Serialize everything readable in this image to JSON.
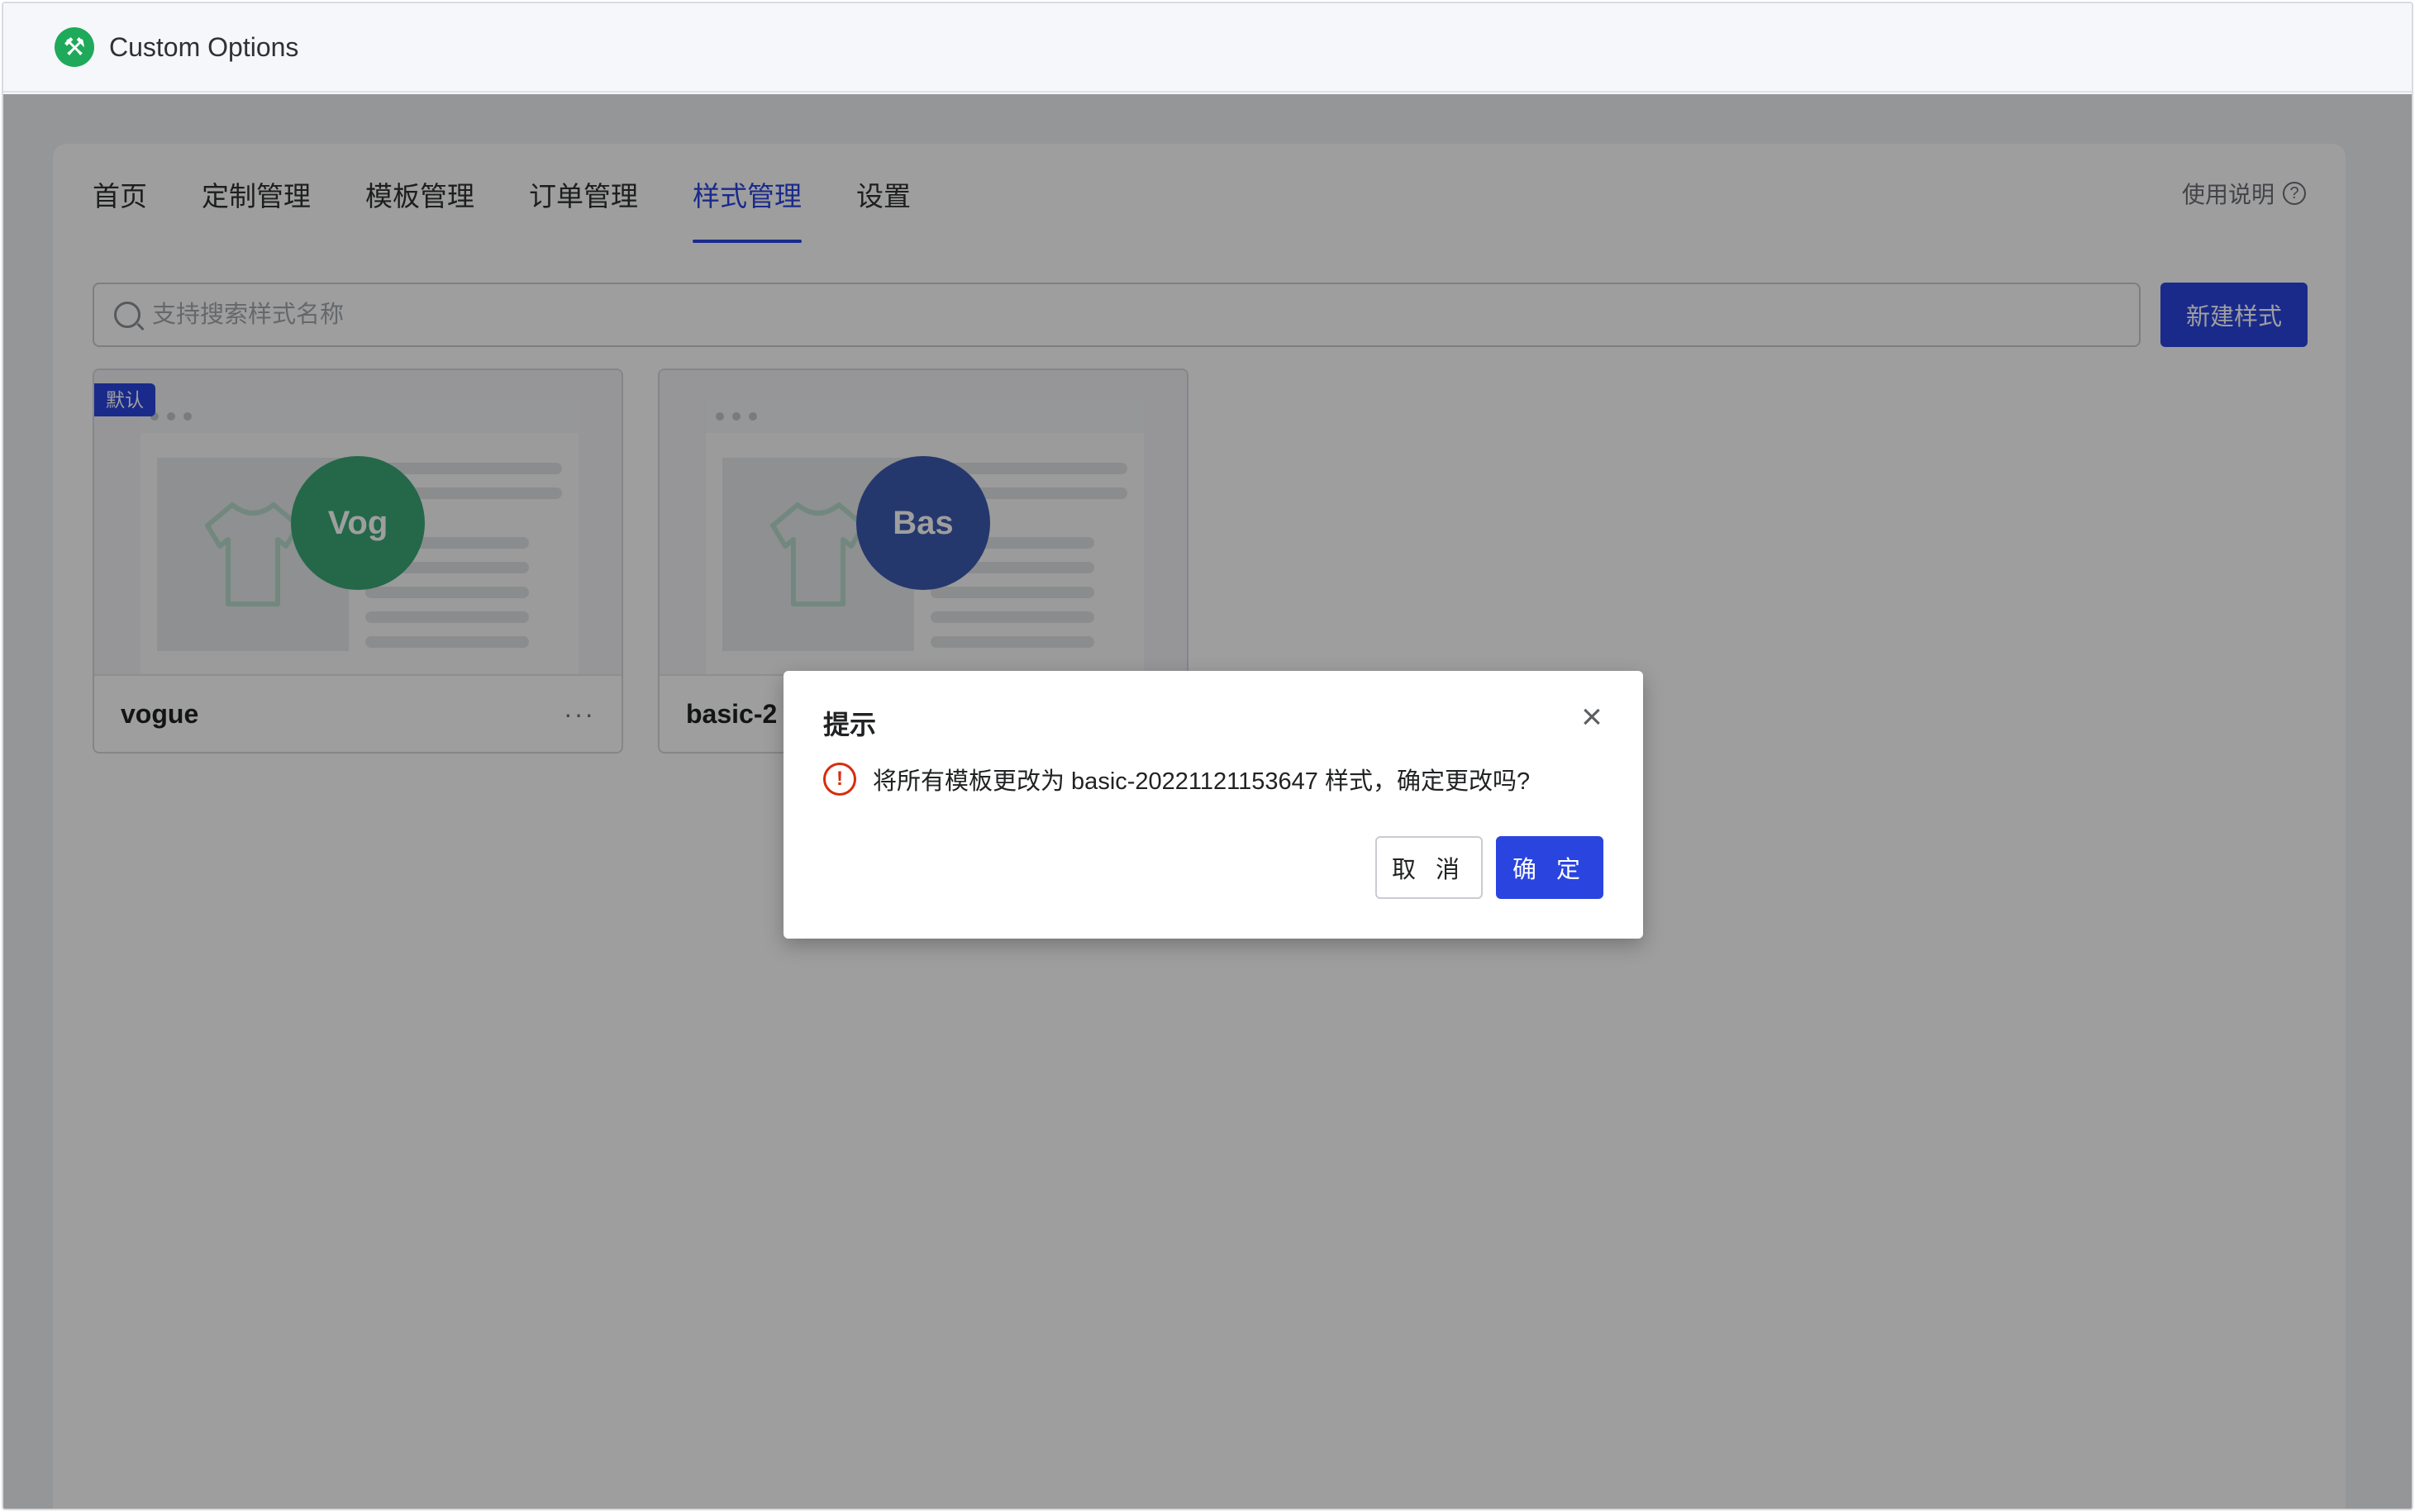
{
  "app": {
    "title": "Custom Options",
    "logo_icon": "tools-icon",
    "accent": "#1fa95b"
  },
  "nav": {
    "tabs": [
      {
        "label": "首页"
      },
      {
        "label": "定制管理"
      },
      {
        "label": "模板管理"
      },
      {
        "label": "订单管理"
      },
      {
        "label": "样式管理",
        "active": true
      },
      {
        "label": "设置"
      }
    ],
    "help_label": "使用说明"
  },
  "search": {
    "placeholder": "支持搜索样式名称",
    "value": ""
  },
  "toolbar": {
    "new_style_label": "新建样式"
  },
  "styles": [
    {
      "name": "vogue",
      "avatar_text": "Vog",
      "avatar_color": "#1fa95b",
      "badge": "默认"
    },
    {
      "name": "basic-2",
      "avatar_text": "Bas",
      "avatar_color": "#2e4aa8",
      "badge": ""
    }
  ],
  "dialog": {
    "title": "提示",
    "message": "将所有模板更改为 basic-20221121153647 样式，确定更改吗?",
    "cancel_label": "取 消",
    "confirm_label": "确 定"
  },
  "colors": {
    "primary": "#2a44e0",
    "warning": "#d72c0d"
  }
}
